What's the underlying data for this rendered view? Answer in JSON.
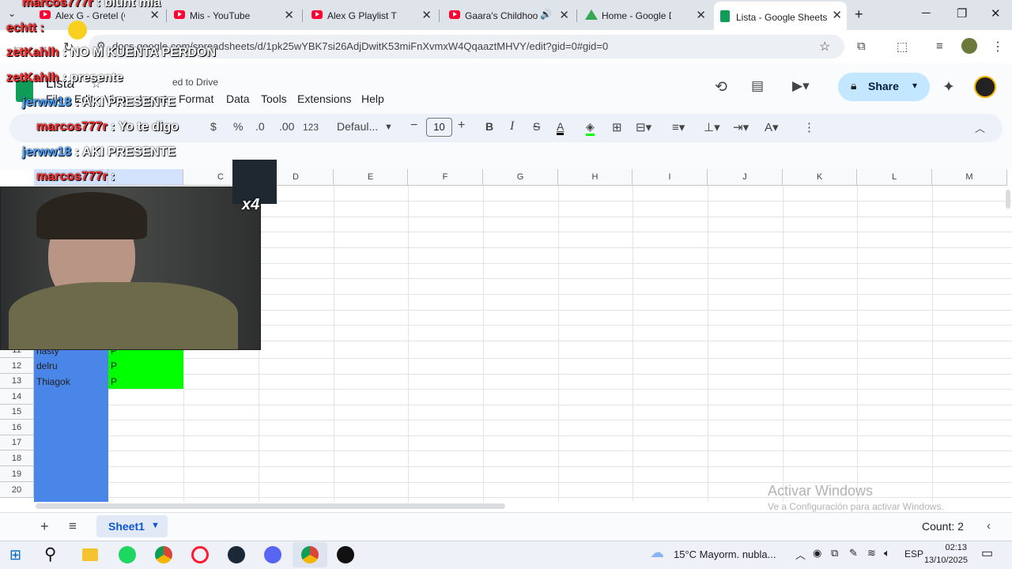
{
  "browser": {
    "tabs": [
      {
        "label": "Alex G - Gretel (Offici",
        "icon": "youtube-icon",
        "active": false
      },
      {
        "label": "Mis - YouTube",
        "icon": "youtube-icon",
        "active": false
      },
      {
        "label": "Alex G Playlist That Yo",
        "icon": "youtube-icon",
        "active": false
      },
      {
        "label": "Gaara's Childhoo",
        "icon": "youtube-icon",
        "active": false
      },
      {
        "label": "Home - Google Drive",
        "icon": "google-drive-icon",
        "active": false
      },
      {
        "label": "Lista - Google Sheets",
        "icon": "google-sheets-icon",
        "active": true
      }
    ],
    "new_tab": "+",
    "url": "docs.google.com/spreadsheets/d/1pk25wYBK7si26AdjDwitK53miFnXvmxW4QqaaztMHVY/edit?gid=0#gid=0"
  },
  "sheets": {
    "doc_title": "Lista",
    "saved_status": "ed to Drive",
    "menus": [
      "File",
      "Edit",
      "View",
      "Insert",
      "Format",
      "Data",
      "Tools",
      "Extensions",
      "Help"
    ],
    "share_label": "Share",
    "toolbar": {
      "currency": "$",
      "percent": "%",
      "dec_dec": ".0",
      "inc_dec": ".00",
      "number_format": "123",
      "font": "Defaul...",
      "font_size": "10",
      "bold": "B",
      "italic": "I",
      "strike": "S",
      "text_color": "A"
    },
    "columns": [
      "B",
      "C",
      "D",
      "E",
      "F",
      "G",
      "H",
      "I",
      "J",
      "K",
      "L",
      "M"
    ],
    "rows": [
      {
        "num": "11",
        "name": "nasty",
        "value": "P"
      },
      {
        "num": "12",
        "name": "delru",
        "value": "P"
      },
      {
        "num": "13",
        "name": "Thiagok",
        "value": "P"
      },
      {
        "num": "14",
        "name": "",
        "value": ""
      },
      {
        "num": "15",
        "name": "",
        "value": ""
      },
      {
        "num": "16",
        "name": "",
        "value": ""
      },
      {
        "num": "17",
        "name": "",
        "value": ""
      },
      {
        "num": "18",
        "name": "",
        "value": ""
      },
      {
        "num": "19",
        "name": "",
        "value": ""
      },
      {
        "num": "20",
        "name": "",
        "value": ""
      }
    ],
    "sheet_tab": "Sheet1",
    "count": "Count: 2",
    "watermark_title": "Activar Windows",
    "watermark_sub": "Ve a Configuración para activar Windows."
  },
  "overlay_chat": [
    {
      "user": "marcos777r",
      "msg": ": blunt mia",
      "color": "#ff2a2a"
    },
    {
      "user": "echtt :",
      "msg": "",
      "color": "#ff2a2a"
    },
    {
      "user": "zetKahlh",
      "msg": ": NO M KUENTA PERDON",
      "color": "#ff2a2a"
    },
    {
      "user": "zetKahlh",
      "msg": ": presente",
      "color": "#ff2a2a"
    },
    {
      "user": "jerww18",
      "msg": ": AKI PRESENTE",
      "color": "#4aa3ff"
    },
    {
      "user": "marcos777r",
      "msg": ": Yo te digo",
      "color": "#ff2a2a"
    },
    {
      "user": "jerww18",
      "msg": ": AKI PRESENTE",
      "color": "#4aa3ff"
    },
    {
      "user": "marcos777r",
      "msg": ":",
      "color": "#ff2a2a"
    }
  ],
  "overlay_badge": "x4",
  "taskbar": {
    "weather": "15°C  Mayorm. nubla...",
    "lang": "ESP",
    "time": "02:13",
    "date": "13/10/2025"
  },
  "colors": {
    "green_fill": "#00ff00",
    "blue_fill": "#4a86e8",
    "share_bg": "#c2e7ff"
  }
}
